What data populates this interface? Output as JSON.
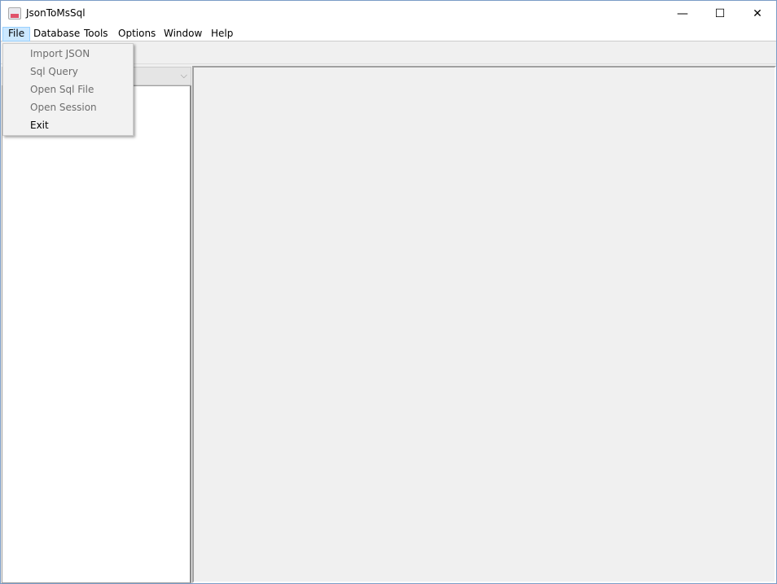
{
  "window": {
    "title": "JsonToMsSql",
    "minimize": "—",
    "maximize": "☐",
    "close": "✕"
  },
  "menubar": [
    "File",
    "Database",
    "Tools",
    "Options",
    "Window",
    "Help"
  ],
  "file_menu": [
    {
      "label": "Import JSON",
      "enabled": false
    },
    {
      "label": "Sql Query",
      "enabled": false
    },
    {
      "label": "Open Sql File",
      "enabled": false
    },
    {
      "label": "Open Session",
      "enabled": false
    },
    {
      "label": "Exit",
      "enabled": true
    }
  ],
  "combo": {
    "arrow": "⌵"
  }
}
